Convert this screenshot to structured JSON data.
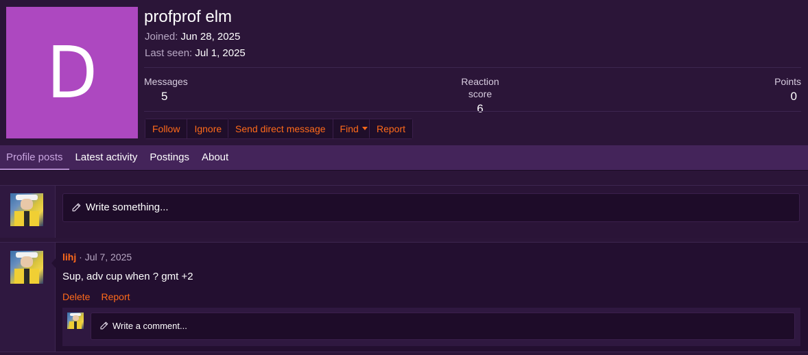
{
  "profile": {
    "avatar_letter": "D",
    "avatar_color": "#ad48c0",
    "username": "profprof elm",
    "joined_label": "Joined:",
    "joined_value": "Jun 28, 2025",
    "last_seen_label": "Last seen:",
    "last_seen_value": "Jul 1, 2025"
  },
  "stats": {
    "messages_label": "Messages",
    "messages_value": "5",
    "reaction_label": "Reaction score",
    "reaction_value": "6",
    "points_label": "Points",
    "points_value": "0"
  },
  "actions": {
    "follow": "Follow",
    "ignore": "Ignore",
    "send_dm": "Send direct message",
    "find": "Find",
    "report": "Report"
  },
  "tabs": [
    {
      "label": "Profile posts",
      "active": true
    },
    {
      "label": "Latest activity",
      "active": false
    },
    {
      "label": "Postings",
      "active": false
    },
    {
      "label": "About",
      "active": false
    }
  ],
  "composer": {
    "placeholder": "Write something..."
  },
  "post": {
    "author": "lihj",
    "separator": "·",
    "date": "Jul 7, 2025",
    "text": "Sup, adv cup when ? gmt +2",
    "delete_label": "Delete",
    "report_label": "Report",
    "comment_placeholder": "Write a comment..."
  },
  "colors": {
    "accent": "#ff6a1a",
    "background": "#2b1538",
    "tab_bar": "#44245a"
  },
  "icons": {
    "pencil": "pencil-icon",
    "caret": "caret-down-icon"
  }
}
